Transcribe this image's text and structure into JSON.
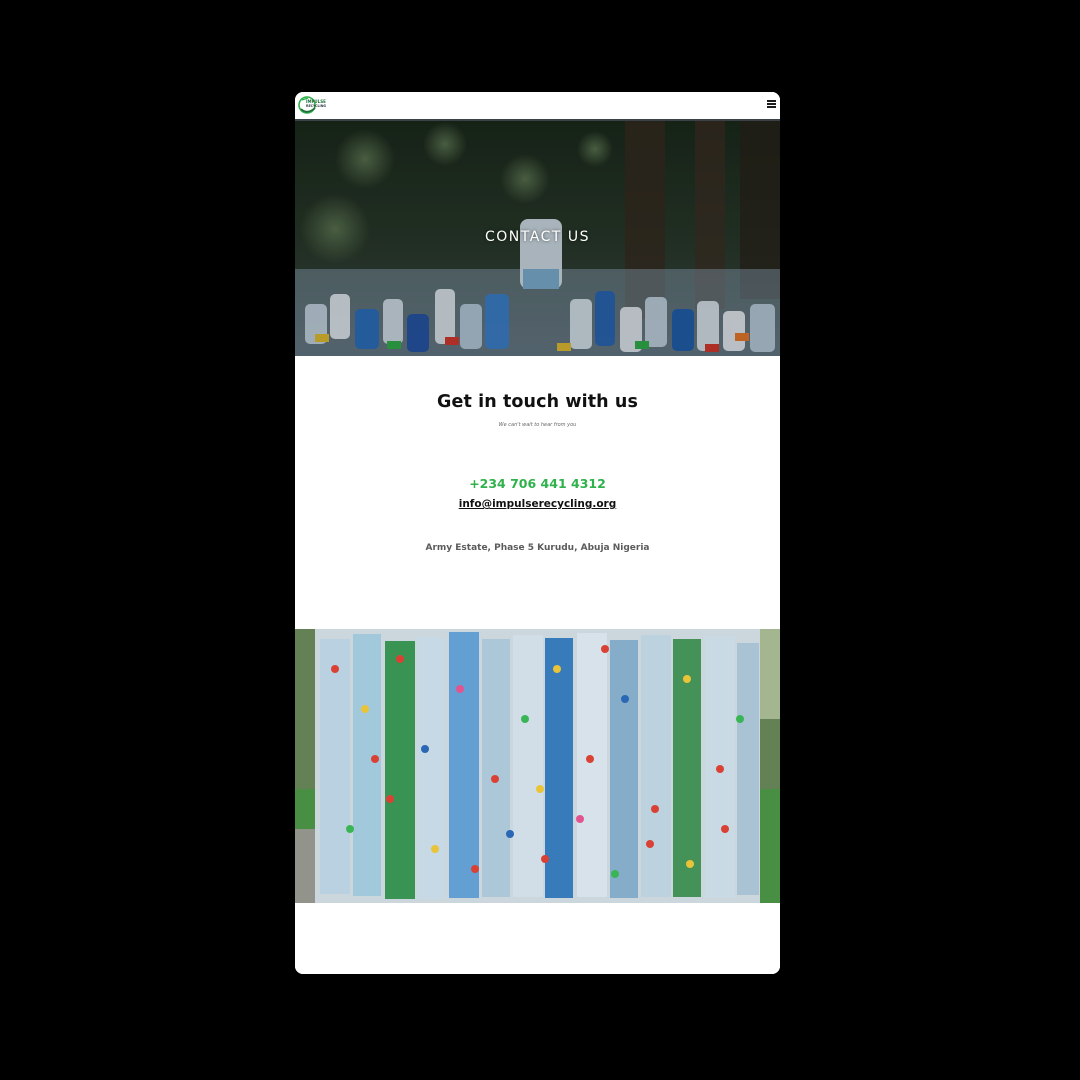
{
  "header": {
    "logo_line1": "IMPULSE",
    "logo_line2": "RECYCLING",
    "menu_icon": "hamburger-menu-icon"
  },
  "hero": {
    "title": "CONTACT US"
  },
  "contact": {
    "heading": "Get in touch with us",
    "subheading": "We can't wait to hear from you",
    "phone": "+234 706 441 4312",
    "email": "info@impulserecycling.org",
    "address": "Army Estate, Phase 5 Kurudu, Abuja Nigeria"
  },
  "colors": {
    "page_background": "#000000",
    "accent_green": "#2fb24c",
    "heading_text": "#111111",
    "address_text": "#5b5b5b"
  }
}
